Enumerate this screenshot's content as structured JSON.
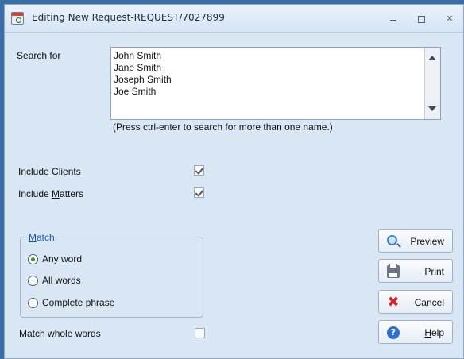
{
  "window": {
    "title": "Editing New Request-REQUEST/7027899",
    "controls": {
      "minimize": "",
      "maximize": "",
      "close": "✕"
    }
  },
  "search": {
    "label_prefix": "",
    "label_access": "S",
    "label_rest": "earch for",
    "names": [
      "John Smith",
      "Jane Smith",
      "Joseph Smith",
      "Joe Smith"
    ],
    "hint": "(Press ctrl-enter to search for more than one name.)"
  },
  "options": {
    "include_clients": {
      "prefix": "Include ",
      "access": "C",
      "rest": "lients",
      "checked": true
    },
    "include_matters": {
      "prefix": "Include ",
      "access": "M",
      "rest": "atters",
      "checked": true
    }
  },
  "match": {
    "legend_prefix": "",
    "legend_access": "M",
    "legend_rest": "atch",
    "options": [
      {
        "label": "Any word",
        "selected": true
      },
      {
        "label": "All words",
        "selected": false
      },
      {
        "label": "Complete phrase",
        "selected": false
      }
    ],
    "whole_words": {
      "prefix": "Match ",
      "access": "w",
      "rest": "hole words",
      "checked": false
    }
  },
  "buttons": {
    "preview": {
      "label": "Preview",
      "icon": "magnifier-icon"
    },
    "print": {
      "label": "Print",
      "icon": "printer-icon"
    },
    "cancel": {
      "label": "Cancel",
      "icon": "cancel-x-icon"
    },
    "help": {
      "prefix": "",
      "access": "H",
      "rest": "elp",
      "icon": "help-icon",
      "icon_glyph": "?"
    }
  },
  "colors": {
    "legend": "#1a57b6",
    "radio_on": "#2a9a2a",
    "cancel_icon": "#d0262a",
    "help_icon": "#2f6fd1"
  }
}
